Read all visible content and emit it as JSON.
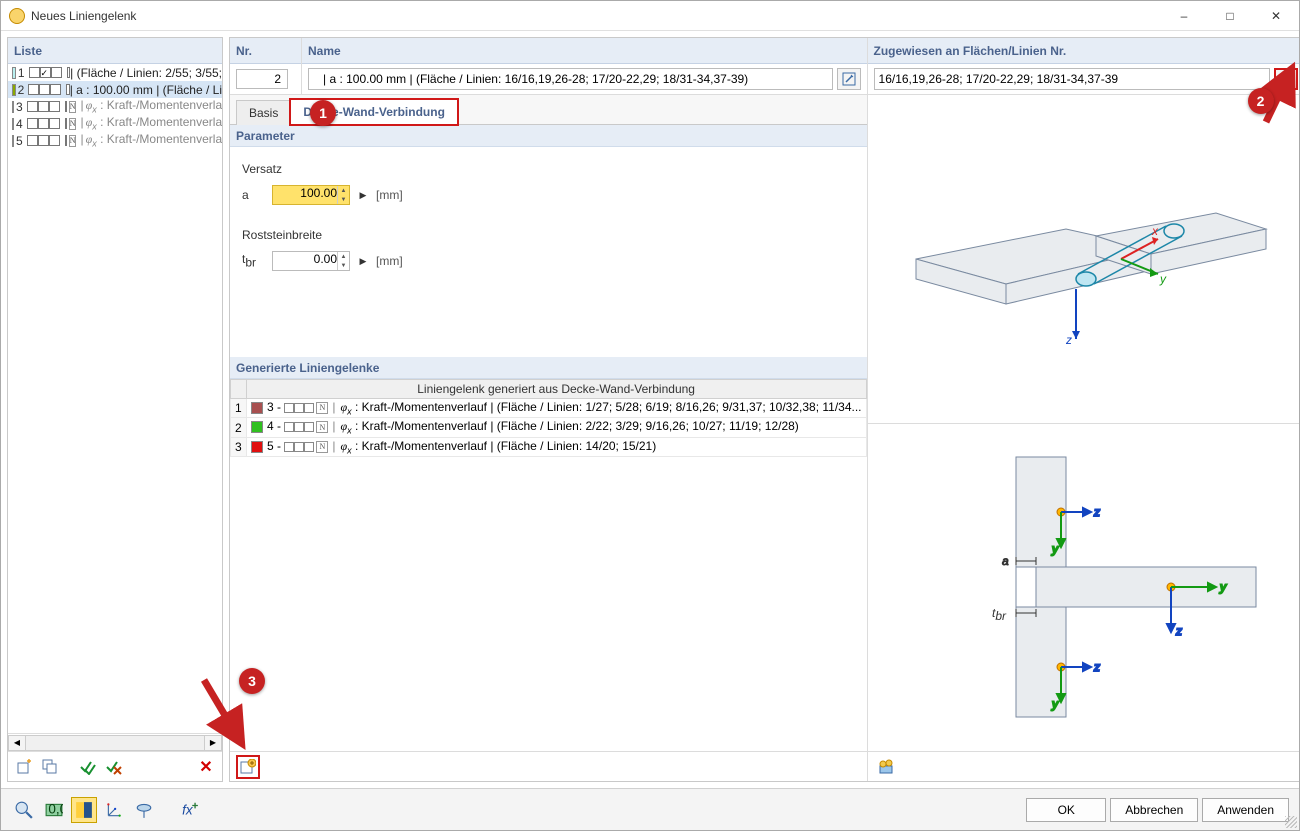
{
  "window": {
    "title": "Neues Liniengelenk",
    "minimize": "–",
    "maximize": "□",
    "close": "✕"
  },
  "list": {
    "header": "Liste",
    "items": [
      {
        "num": "1",
        "color": "#b9f0f0",
        "checks": [
          false,
          true,
          false,
          false
        ],
        "n": false,
        "gray": false,
        "selected": false,
        "text": "| (Fläche / Linien: 2/55; 3/55;"
      },
      {
        "num": "2",
        "color": "#8aa800",
        "checks": [
          false,
          false,
          false,
          false
        ],
        "n": false,
        "gray": false,
        "selected": true,
        "text": "| a : 100.00 mm | (Fläche / Li"
      },
      {
        "num": "3",
        "color": "#a85050",
        "checks": [
          false,
          false,
          false,
          false
        ],
        "n": true,
        "gray": true,
        "selected": false,
        "phi": "φₓ",
        "text": " : Kraft-/Momentenverlau"
      },
      {
        "num": "4",
        "color": "#30c020",
        "checks": [
          false,
          false,
          false,
          false
        ],
        "n": true,
        "gray": true,
        "selected": false,
        "phi": "φₓ",
        "text": " : Kraft-/Momentenverlau"
      },
      {
        "num": "5",
        "color": "#e01010",
        "checks": [
          false,
          false,
          false,
          false
        ],
        "n": true,
        "gray": true,
        "selected": false,
        "phi": "φₓ",
        "text": " : Kraft-/Momentenverlau"
      }
    ],
    "delete_tooltip": "Löschen"
  },
  "head": {
    "nr_label": "Nr.",
    "nr_value": "2",
    "name_label": "Name",
    "name_value": "| a : 100.00 mm | (Fläche / Linien: 16/16,19,26-28; 17/20-22,29; 18/31-34,37-39)",
    "assign_label": "Zugewiesen an Flächen/Linien Nr.",
    "assign_value": "16/16,19,26-28; 17/20-22,29; 18/31-34,37-39"
  },
  "tabs": {
    "basis": "Basis",
    "dwv": "Decke-Wand-Verbindung"
  },
  "params": {
    "header": "Parameter",
    "versatz_label": "Versatz",
    "a_sym": "a",
    "a_val": "100.00",
    "rost_label": "Roststeinbreite",
    "tbr_sym": "tbr",
    "tbr_val": "0.00",
    "unit": "[mm]"
  },
  "gen": {
    "header": "Generierte Liniengelenke",
    "colhead": "Liniengelenk generiert aus Decke-Wand-Verbindung",
    "rows": [
      {
        "idx": "1",
        "num": "3",
        "color": "#a85050",
        "phi": "φₓ",
        "text": " : Kraft-/Momentenverlauf | (Fläche / Linien: 1/27; 5/28; 6/19; 8/16,26; 9/31,37; 10/32,38; 11/34..."
      },
      {
        "idx": "2",
        "num": "4",
        "color": "#30c020",
        "phi": "φₓ",
        "text": " : Kraft-/Momentenverlauf | (Fläche / Linien: 2/22; 3/29; 9/16,26; 10/27; 11/19; 12/28)"
      },
      {
        "idx": "3",
        "num": "5",
        "color": "#e01010",
        "phi": "φₓ",
        "text": " : Kraft-/Momentenverlauf | (Fläche / Linien: 14/20; 15/21)"
      }
    ]
  },
  "diagram": {
    "x_label": "x",
    "y_label": "y",
    "z_label": "z",
    "a_label": "a",
    "tbr_label": "t",
    "tbr_sub": "br"
  },
  "footer": {
    "ok": "OK",
    "cancel": "Abbrechen",
    "apply": "Anwenden"
  },
  "callouts": {
    "c1": "1",
    "c2": "2",
    "c3": "3"
  }
}
